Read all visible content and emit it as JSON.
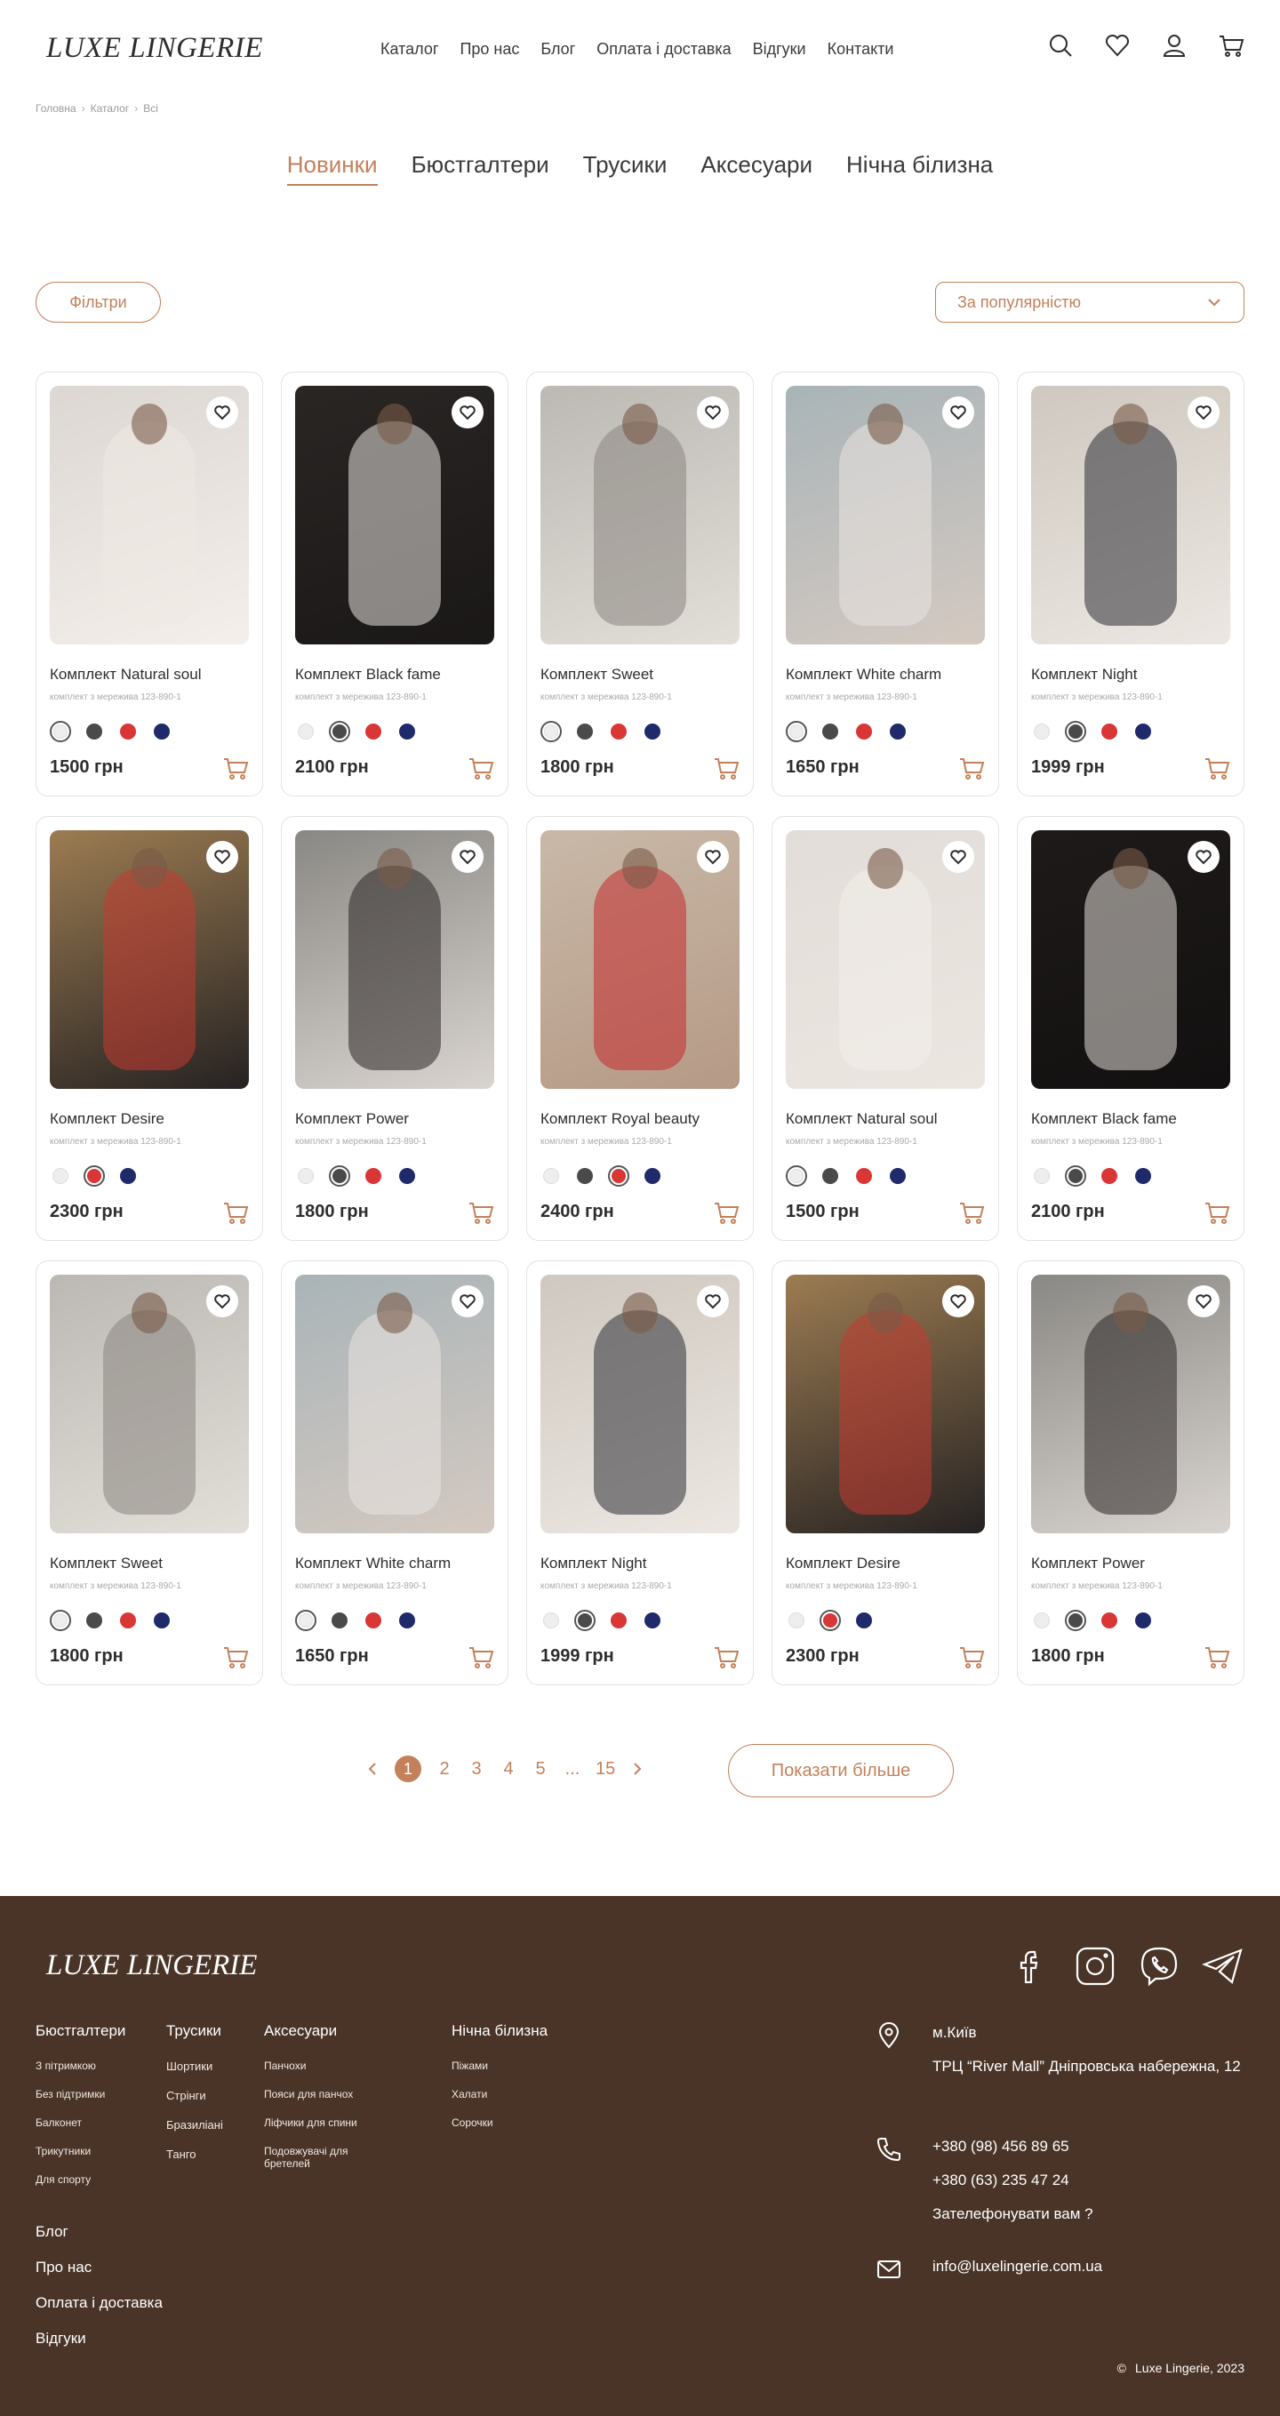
{
  "header": {
    "logo": "LUXE LINGERIE",
    "nav": [
      "Каталог",
      "Про нас",
      "Блог",
      "Оплата і доставка",
      "Відгуки",
      "Контакти"
    ],
    "icons": [
      "search-icon",
      "heart-icon",
      "user-icon",
      "cart-icon"
    ]
  },
  "breadcrumb": [
    "Головна",
    "Каталог",
    "Всі"
  ],
  "categories": [
    "Новинки",
    "Бюстгалтери",
    "Трусики",
    "Аксесуари",
    "Нічна білизна"
  ],
  "toolbar": {
    "filters_label": "Фільтри",
    "sort_label": "За популярністю"
  },
  "products": [
    {
      "name": "Комплект Natural soul",
      "desc": "комплект з мережива 123-890-1",
      "price": "1500 грн",
      "selected": 0
    },
    {
      "name": "Комплект Black fame",
      "desc": "комплект з мережива 123-890-1",
      "price": "2100 грн",
      "selected": 1
    },
    {
      "name": "Комплект Sweet",
      "desc": "комплект з мережива 123-890-1",
      "price": "1800 грн",
      "selected": 0
    },
    {
      "name": "Комплект White charm",
      "desc": "комплект з мережива 123-890-1",
      "price": "1650 грн",
      "selected": 0
    },
    {
      "name": "Комплект Night",
      "desc": "комплект з мережива 123-890-1",
      "price": "1999 грн",
      "selected": 1
    },
    {
      "name": "Комплект Desire",
      "desc": "комплект з мережива 123-890-1",
      "price": "2300 грн",
      "selected": 1,
      "swatches": 3
    },
    {
      "name": "Комплект Power",
      "desc": "комплект з мережива 123-890-1",
      "price": "1800 грн",
      "selected": 1
    },
    {
      "name": "Комплект Royal beauty",
      "desc": "комплект з мережива 123-890-1",
      "price": "2400 грн",
      "selected": 2
    },
    {
      "name": "Комплект Natural soul",
      "desc": "комплект з мережива 123-890-1",
      "price": "1500 грн",
      "selected": 0
    },
    {
      "name": "Комплект  Black fame",
      "desc": "комплект з мережива 123-890-1",
      "price": "2100 грн",
      "selected": 1
    },
    {
      "name": "Комплект Sweet",
      "desc": "комплект з мережива 123-890-1",
      "price": "1800 грн",
      "selected": 0
    },
    {
      "name": "Комплект White charm",
      "desc": "комплект з мережива 123-890-1",
      "price": "1650 грн",
      "selected": 0
    },
    {
      "name": "Комплект Night",
      "desc": "комплект з мережива 123-890-1",
      "price": "1999 грн",
      "selected": 1
    },
    {
      "name": "Комплект Desire",
      "desc": "комплект з мережива 123-890-1",
      "price": "2300 грн",
      "selected": 1,
      "swatches": 3
    },
    {
      "name": "Комплект Power",
      "desc": "комплект з мережива 123-890-1",
      "price": "1800 грн",
      "selected": 1
    }
  ],
  "swatch_colors": [
    "#eeeeee",
    "#4a4a4a",
    "#d93636",
    "#1f2a6b"
  ],
  "desire_colors": [
    "#eeeeee",
    "#d93636",
    "#1f2a6b"
  ],
  "pagination": {
    "pages": [
      "1",
      "2",
      "3",
      "4",
      "5",
      "...",
      "15"
    ],
    "current": "1",
    "more_label": "Показати більше"
  },
  "footer": {
    "logo": "LUXE LINGERIE",
    "social": [
      "facebook-icon",
      "instagram-icon",
      "viber-icon",
      "telegram-icon"
    ],
    "columns": [
      {
        "title": "Бюстгалтери",
        "items": [
          "З пітримкою",
          "Без підтримки",
          "Балконет",
          "Трикутники",
          "Для спорту"
        ]
      },
      {
        "title": "Трусики",
        "items": [
          "Шортики",
          "Стрінги",
          "Бразиліані",
          "Танго"
        ]
      },
      {
        "title": "Аксесуари",
        "items": [
          "Панчохи",
          "Пояси для панчох",
          "Ліфчики для спини",
          "Подовжувачі для бретелей"
        ]
      },
      {
        "title": "Нічна білизна",
        "items": [
          "Піжами",
          "Халати",
          "Сорочки"
        ]
      }
    ],
    "links": [
      "Блог",
      "Про нас",
      "Оплата і доставка",
      "Відгуки"
    ],
    "city": "м.Київ",
    "address": "ТРЦ “River Mall” Дніпровська набережна, 12",
    "phone1": "+380 (98) 456 89 65",
    "phone2": "+380 (63) 235 47 24",
    "callback": "Зателефонувати вам ?",
    "email": "info@luxelingerie.com.ua",
    "copyright": "Luxe Lingerie, 2023"
  },
  "accent_color": "#c4805a",
  "footer_bg": "#4a3428"
}
